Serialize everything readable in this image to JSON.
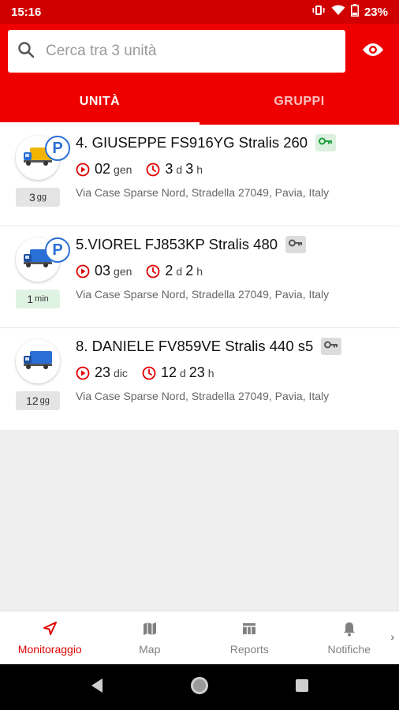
{
  "status_bar": {
    "time": "15:16",
    "battery": "23%"
  },
  "search": {
    "placeholder": "Cerca tra 3 unità"
  },
  "tabs": [
    {
      "label": "UNITÀ"
    },
    {
      "label": "GRUPPI"
    }
  ],
  "units": [
    {
      "title": "4. GIUSEPPE FS916YG Stralis 260",
      "parked": true,
      "key_status": "green",
      "date_num": "02",
      "date_month": "gen",
      "dur_days": "3",
      "dur_d": "d",
      "dur_hours": "3",
      "dur_h": "h",
      "age_num": "3",
      "age_unit": "gg",
      "age_fresh": false,
      "address": "Via Case Sparse Nord, Stradella 27049, Pavia, Italy",
      "truck_color": "#f0b400"
    },
    {
      "title": "5.VIOREL FJ853KP Stralis 480",
      "parked": true,
      "key_status": "gray",
      "date_num": "03",
      "date_month": "gen",
      "dur_days": "2",
      "dur_d": "d",
      "dur_hours": "2",
      "dur_h": "h",
      "age_num": "1",
      "age_unit": "min",
      "age_fresh": true,
      "address": "Via Case Sparse Nord, Stradella 27049, Pavia, Italy",
      "truck_color": "#2a6fd6"
    },
    {
      "title": "8. DANIELE FV859VE Stralis 440 s5",
      "parked": false,
      "key_status": "gray",
      "date_num": "23",
      "date_month": "dic",
      "dur_days": "12",
      "dur_d": "d",
      "dur_hours": "23",
      "dur_h": "h",
      "age_num": "12",
      "age_unit": "gg",
      "age_fresh": false,
      "address": "Via Case Sparse Nord, Stradella 27049, Pavia, Italy",
      "truck_color": "#2a6fd6"
    }
  ],
  "bottom_nav": [
    {
      "label": "Monitoraggio",
      "icon": "navigation-arrow-icon"
    },
    {
      "label": "Map",
      "icon": "map-icon"
    },
    {
      "label": "Reports",
      "icon": "reports-table-icon"
    },
    {
      "label": "Notifiche",
      "icon": "bell-icon"
    }
  ],
  "colors": {
    "accent": "#ee0000",
    "status_bar": "#d00000",
    "parked_blue": "#2a6fd6"
  }
}
